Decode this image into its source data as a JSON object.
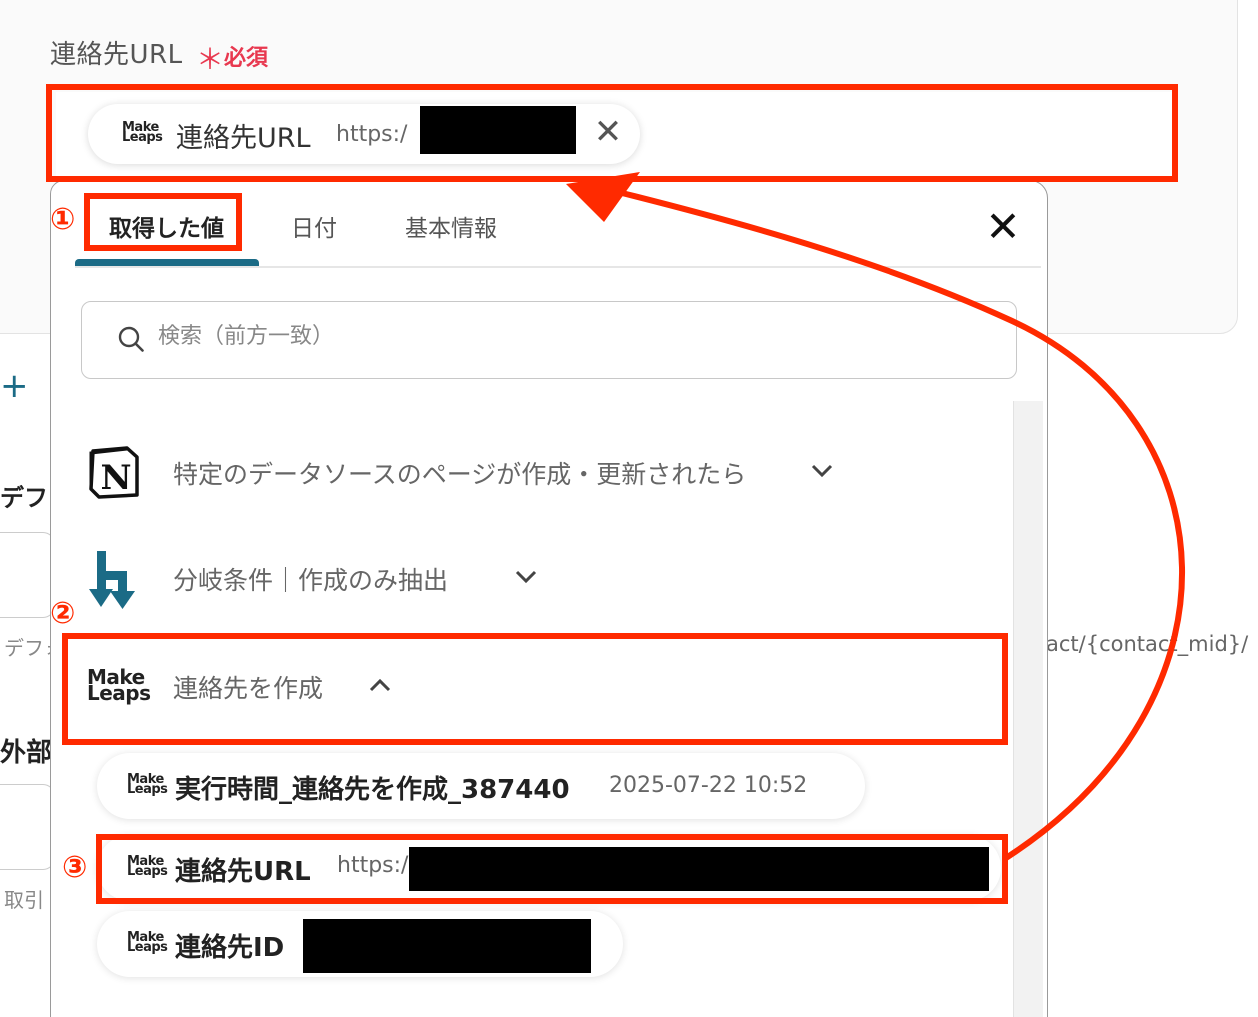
{
  "field": {
    "label": "連絡先URL",
    "required_mark": "＊",
    "required_text": "必須",
    "chip": {
      "logo_top": "Make",
      "logo_bottom": "Leaps",
      "name": "連絡先URL",
      "value": "https:/"
    }
  },
  "side": {
    "plus": "+",
    "t1": "デフォ",
    "t2": "デフォ",
    "t3": "外部I",
    "t4": "取引",
    "right_url": "act/{contact_mid}/"
  },
  "popup": {
    "tabs": [
      {
        "label": "取得した値",
        "active": true
      },
      {
        "label": "日付",
        "active": false
      },
      {
        "label": "基本情報",
        "active": false
      }
    ],
    "search_placeholder": "検索（前方一致）",
    "groups": [
      {
        "label": "特定のデータソースのページが作成・更新されたら",
        "icon": "notion-icon",
        "expanded": false
      },
      {
        "label": "分岐条件｜作成のみ抽出",
        "icon": "branch-icon",
        "expanded": false
      },
      {
        "label": "連絡先を作成",
        "icon": "makeleaps-icon",
        "expanded": true
      }
    ],
    "items": [
      {
        "name": "実行時間_連絡先を作成_387440",
        "value": "2025-07-22 10:52"
      },
      {
        "name": "連絡先URL",
        "value": "https:/"
      },
      {
        "name": "連絡先ID",
        "value": ""
      }
    ]
  },
  "annotations": {
    "n1": "①",
    "n2": "②",
    "n3": "③"
  },
  "colors": {
    "accent": "#1b6b86",
    "annotation": "#ff2a00",
    "required": "#e8384f"
  }
}
